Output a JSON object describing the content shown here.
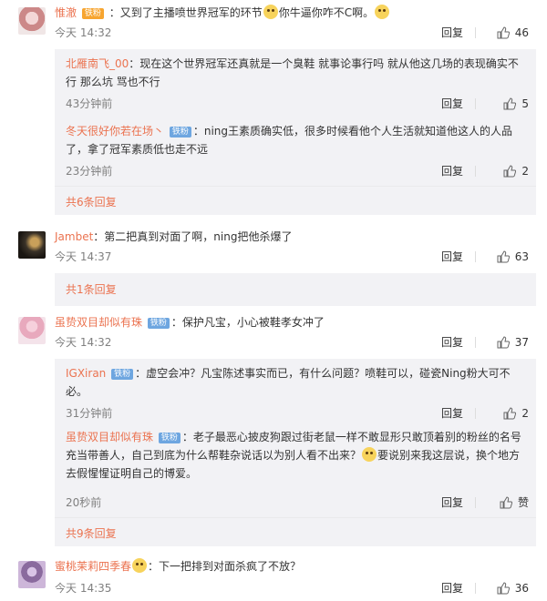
{
  "comments": [
    {
      "user": "惟澈",
      "badge": "铁粉",
      "text_a": "：又到了主播喷世界冠军的环节",
      "text_b": "你牛逼你咋不C啊。",
      "time": "今天 14:32",
      "reply": "回复",
      "likes": "46",
      "replies": [
        {
          "user": "北雁南飞_00",
          "text": "：现在这个世界冠军还真就是一个臭鞋 就事论事行吗 就从他这几场的表现确实不行 那么坑 骂也不行",
          "time": "43分钟前",
          "reply": "回复",
          "likes": "5"
        },
        {
          "user": "冬天很好你若在场丶",
          "badge": "铁粉",
          "text": "：ning王素质确实低，很多时候看他个人生活就知道他这人的人品了，拿了冠军素质低也走不远",
          "time": "23分钟前",
          "reply": "回复",
          "likes": "2"
        }
      ],
      "more": "共6条回复"
    },
    {
      "user": "Jambet",
      "text_a": "：第二把真到对面了啊，ning把他杀爆了",
      "time": "今天 14:37",
      "reply": "回复",
      "likes": "63",
      "more": "共1条回复"
    },
    {
      "user": "虽贽双目却似有珠",
      "badge": "铁粉",
      "text_a": "：保护凡宝，小心被鞋孝女冲了",
      "time": "今天 14:32",
      "reply": "回复",
      "likes": "37",
      "replies": [
        {
          "user": "IGXiran",
          "badge": "铁粉",
          "text": "：虚空会冲？凡宝陈述事实而已，有什么问题？喷鞋可以，碰瓷Ning粉大可不必。",
          "time": "31分钟前",
          "reply": "回复",
          "likes": "2"
        },
        {
          "user": "虽贽双目却似有珠",
          "badge": "铁粉",
          "text": "：老子最恶心披皮狗跟过街老鼠一样不敢显形只敢顶着别的粉丝的名号充当带善人，自己到底为什么帮鞋杂说话以为别人看不出来？",
          "text_b": "要说别来我这层说，换个地方去假惺惺证明自己的博爱。",
          "time": "20秒前",
          "reply": "回复",
          "likes": "赞"
        }
      ],
      "more": "共9条回复"
    },
    {
      "user": "蜜桃茉莉四季春",
      "text_a": "：下一把排到对面杀疯了不放？",
      "time": "今天 14:35",
      "reply": "回复",
      "likes": "36"
    }
  ]
}
